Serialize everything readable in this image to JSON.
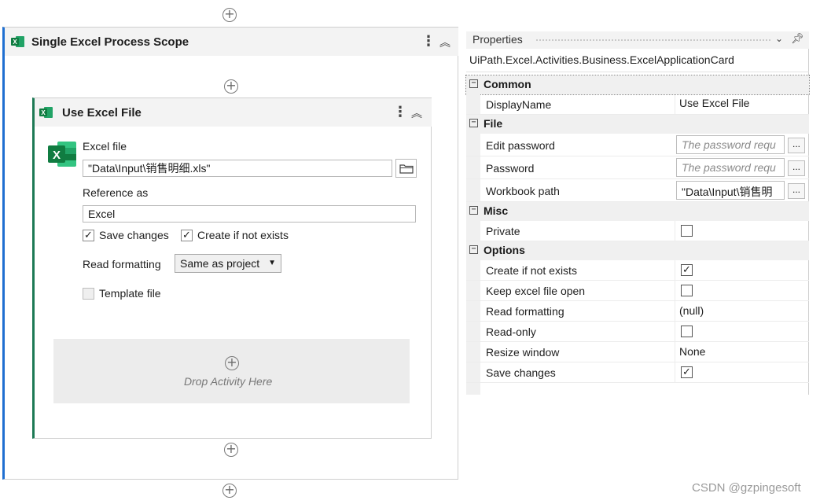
{
  "designer": {
    "outer_scope": {
      "title": "Single Excel Process Scope"
    },
    "use_excel": {
      "title": "Use Excel File",
      "excel_file_label": "Excel file",
      "excel_file_value": "\"Data\\Input\\销售明细.xls\"",
      "reference_as_label": "Reference as",
      "reference_as_value": "Excel",
      "save_changes_label": "Save changes",
      "save_changes_checked": true,
      "create_if_not_exists_label": "Create if not exists",
      "create_if_not_exists_checked": true,
      "read_formatting_label": "Read formatting",
      "read_formatting_value": "Same as project",
      "template_file_label": "Template file",
      "template_file_checked": false,
      "drop_text": "Drop Activity Here"
    },
    "add_icon": "⊕"
  },
  "properties": {
    "title": "Properties",
    "class_name": "UiPath.Excel.Activities.Business.ExcelApplicationCard",
    "categories": {
      "common": "Common",
      "file": "File",
      "misc": "Misc",
      "options": "Options"
    },
    "rows": {
      "display_name": {
        "name": "DisplayName",
        "value": "Use Excel File"
      },
      "edit_password": {
        "name": "Edit password",
        "value": "The password requ"
      },
      "password": {
        "name": "Password",
        "value": "The password requ"
      },
      "workbook_path": {
        "name": "Workbook path",
        "value": "\"Data\\Input\\销售明"
      },
      "private": {
        "name": "Private",
        "checked": false
      },
      "create_if_not_exists": {
        "name": "Create if not exists",
        "checked": true
      },
      "keep_excel_file_open": {
        "name": "Keep excel file open",
        "checked": false
      },
      "read_formatting": {
        "name": "Read formatting",
        "value": "(null)"
      },
      "read_only": {
        "name": "Read-only",
        "checked": false
      },
      "resize_window": {
        "name": "Resize window",
        "value": "None"
      },
      "save_changes": {
        "name": "Save changes",
        "checked": true
      }
    },
    "ellipsis": "..."
  },
  "watermark": "CSDN @gzpingesoft"
}
